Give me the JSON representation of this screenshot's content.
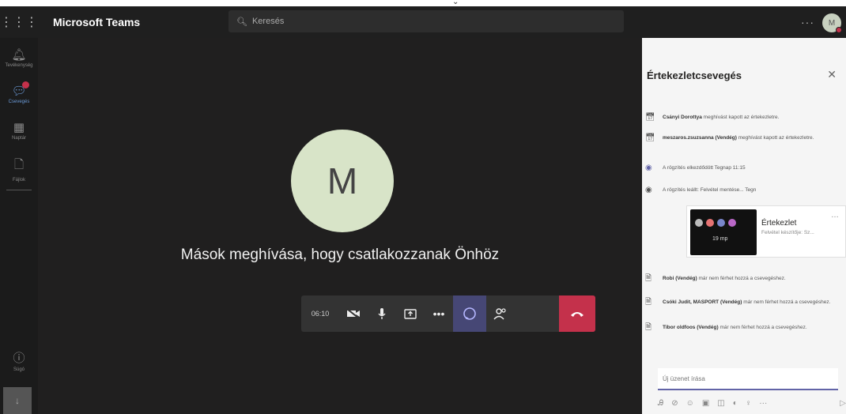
{
  "titlebar": {
    "app_title": "Microsoft Teams",
    "search_placeholder": "Keresés",
    "more_label": "···",
    "avatar_initials": "M"
  },
  "rail": {
    "items": [
      {
        "label": "Tevékenység",
        "icon": "bell-icon"
      },
      {
        "label": "Csevegés",
        "icon": "chat-icon"
      },
      {
        "label": "Naptár",
        "icon": "calendar-icon"
      },
      {
        "label": "Fájlok",
        "icon": "file-icon"
      }
    ],
    "help_label": "Súgó"
  },
  "stage": {
    "avatar_letter": "M",
    "invite_text": "Mások meghívása, hogy csatlakozzanak Önhöz",
    "timer": "06:10"
  },
  "panel": {
    "title": "Értekezletcsevegés",
    "messages": [
      {
        "name": "Csányi Dorottya",
        "text": "meghívást kapott az értekezletre."
      },
      {
        "name": "meszaros.zsuzsanna (Vendég)",
        "text": "meghívást kapott az értekezletre."
      },
      {
        "name": "",
        "text": "A rögzítés elkezdődött    Tegnap 11:15"
      },
      {
        "name": "",
        "text": "A rögzítés leállt: Felvétel mentése...    Tegn"
      },
      {
        "name": "Robi (Vendég)",
        "text": "már nem férhet hozzá a csevegéshez."
      },
      {
        "name": "Csóki Judit, MASPORT (Vendég)",
        "text": "már nem férhet hozzá a csevegéshez."
      },
      {
        "name": "Tibor oldfoos (Vendég)",
        "text": "már nem férhet hozzá a csevegéshez."
      }
    ],
    "recording_card": {
      "title": "Értekezlet",
      "subtitle": "Felvétel készítője: Sz...",
      "duration": "19 mp"
    },
    "compose_placeholder": "Új üzenet írása"
  },
  "colors": {
    "hangup": "#c4314b",
    "chat_active": "#464775",
    "accent": "#6264a7"
  }
}
